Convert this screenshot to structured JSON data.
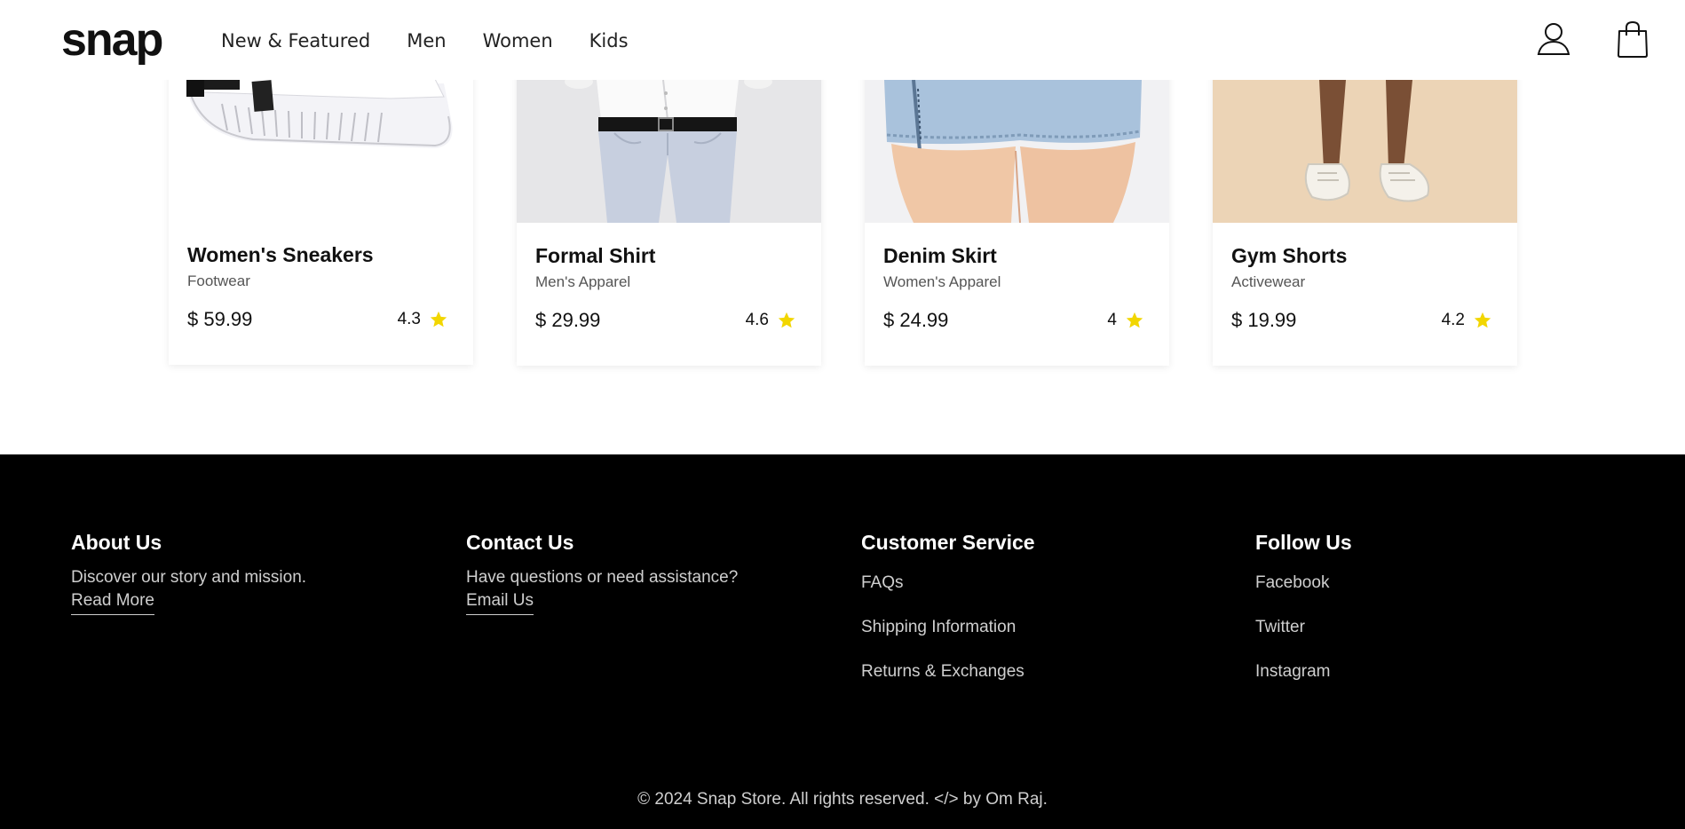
{
  "header": {
    "logo": "snap",
    "nav": [
      "New & Featured",
      "Men",
      "Women",
      "Kids"
    ]
  },
  "products": [
    {
      "name": "Women's Sneakers",
      "category": "Footwear",
      "price": "$ 59.99",
      "rating": "4.3",
      "image": "white-sneaker-photo"
    },
    {
      "name": "Formal Shirt",
      "category": "Men's Apparel",
      "price": "$ 29.99",
      "rating": "4.6",
      "image": "formal-outfit-photo"
    },
    {
      "name": "Denim Skirt",
      "category": "Women's Apparel",
      "price": "$ 24.99",
      "rating": "4",
      "image": "denim-skirt-photo"
    },
    {
      "name": "Gym Shorts",
      "category": "Activewear",
      "price": "$ 19.99",
      "rating": "4.2",
      "image": "sneakers-legs-photo"
    }
  ],
  "footer": {
    "about": {
      "title": "About Us",
      "text": "Discover our story and mission.",
      "link": "Read More"
    },
    "contact": {
      "title": "Contact Us",
      "text": "Have questions or need assistance?",
      "link": "Email Us"
    },
    "service": {
      "title": "Customer Service",
      "links": [
        "FAQs",
        "Shipping Information",
        "Returns & Exchanges"
      ]
    },
    "follow": {
      "title": "Follow Us",
      "links": [
        "Facebook",
        "Twitter",
        "Instagram"
      ]
    },
    "copyright": "© 2024 Snap Store. All rights reserved. </> by Om Raj."
  },
  "colors": {
    "star": "#f2d600",
    "footer_bg": "#000000"
  },
  "icons": [
    "user-icon",
    "shopping-bag-icon",
    "star-icon"
  ]
}
